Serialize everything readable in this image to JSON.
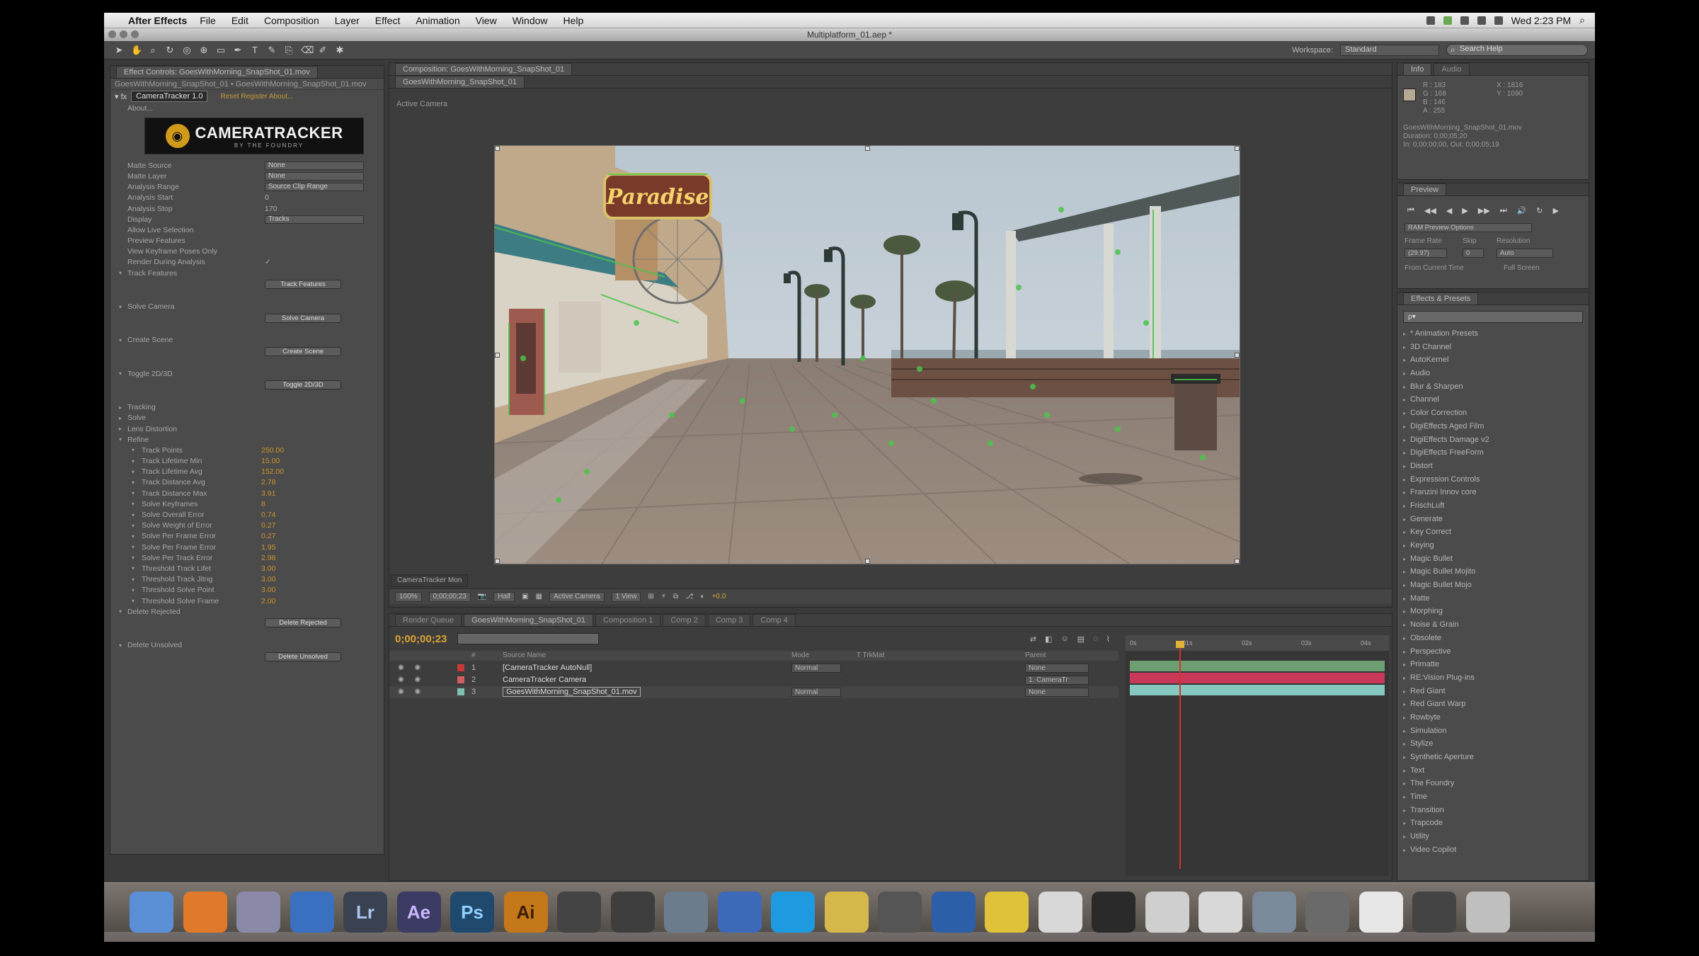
{
  "menubar": {
    "app": "After Effects",
    "items": [
      "File",
      "Edit",
      "Composition",
      "Layer",
      "Effect",
      "Animation",
      "View",
      "Window",
      "Help"
    ],
    "clock": "Wed 2:23 PM"
  },
  "window_title": "Multiplatform_01.aep *",
  "toolbar": {
    "workspace_label": "Workspace:",
    "workspace_value": "Standard",
    "help_placeholder": "Search Help"
  },
  "effect_controls": {
    "tab": "Effect Controls: GoesWithMorning_SnapShot_01.mov",
    "subtitle": "GoesWithMorning_SnapShot_01 • GoesWithMorning_SnapShot_01.mov",
    "effect_name": "CameraTracker 1.0",
    "effect_links": "Reset   Register   About...",
    "about": "About...",
    "logo_text": "CAMERATRACKER",
    "logo_sub": "BY THE FOUNDRY",
    "rows": [
      {
        "label": "Matte Source",
        "kind": "sel",
        "value": "None"
      },
      {
        "label": "Matte Layer",
        "kind": "sel",
        "value": "None"
      },
      {
        "label": "Analysis Range",
        "kind": "sel",
        "value": "Source Clip Range"
      },
      {
        "label": "Analysis Start",
        "kind": "val",
        "value": "0"
      },
      {
        "label": "Analysis Stop",
        "kind": "val",
        "value": "170"
      },
      {
        "label": "Display",
        "kind": "sel",
        "value": "Tracks"
      },
      {
        "label": "Allow Live Selection",
        "kind": "val",
        "value": ""
      },
      {
        "label": "Preview Features",
        "kind": "val",
        "value": ""
      },
      {
        "label": "View Keyframe Poses Only",
        "kind": "val",
        "value": ""
      },
      {
        "label": "Render During Analysis",
        "kind": "val",
        "value": "✓"
      },
      {
        "label": "Track Features",
        "kind": "sec",
        "value": ""
      },
      {
        "label": "",
        "kind": "btn",
        "value": "Track Features"
      },
      {
        "label": "",
        "kind": "gap",
        "value": ""
      },
      {
        "label": "Solve Camera",
        "kind": "sec",
        "value": ""
      },
      {
        "label": "",
        "kind": "btn",
        "value": "Solve Camera"
      },
      {
        "label": "",
        "kind": "gap",
        "value": ""
      },
      {
        "label": "Create Scene",
        "kind": "sec",
        "value": ""
      },
      {
        "label": "",
        "kind": "btn",
        "value": "Create Scene"
      },
      {
        "label": "",
        "kind": "gap",
        "value": ""
      },
      {
        "label": "Toggle 2D/3D",
        "kind": "sec",
        "value": ""
      },
      {
        "label": "",
        "kind": "btn",
        "value": "Toggle 2D/3D"
      },
      {
        "label": "",
        "kind": "gap",
        "value": ""
      },
      {
        "label": "Tracking",
        "kind": "sec2",
        "value": ""
      },
      {
        "label": "Solve",
        "kind": "sec2",
        "value": ""
      },
      {
        "label": "Lens Distortion",
        "kind": "sec2",
        "value": ""
      },
      {
        "label": "Refine",
        "kind": "sec",
        "value": ""
      },
      {
        "label": "Track Points",
        "kind": "gold",
        "value": "250.00"
      },
      {
        "label": "Track Lifetime Min",
        "kind": "gold",
        "value": "15.00"
      },
      {
        "label": "Track Lifetime Avg",
        "kind": "gold",
        "value": "152.00"
      },
      {
        "label": "Track Distance Avg",
        "kind": "gold",
        "value": "2.78"
      },
      {
        "label": "Track Distance Max",
        "kind": "gold",
        "value": "3.91"
      },
      {
        "label": "Solve Keyframes",
        "kind": "gold",
        "value": "8"
      },
      {
        "label": "Solve Overall Error",
        "kind": "gold",
        "value": "0.74"
      },
      {
        "label": "Solve Weight of Error",
        "kind": "gold",
        "value": "0.27"
      },
      {
        "label": "Solve Per Frame Error",
        "kind": "gold",
        "value": "0.27"
      },
      {
        "label": "Solve Per Frame Error",
        "kind": "gold",
        "value": "1.95"
      },
      {
        "label": "Solve Per Track Error",
        "kind": "gold",
        "value": "2.98"
      },
      {
        "label": "Threshold Track Lifet",
        "kind": "gold",
        "value": "3.00"
      },
      {
        "label": "Threshold Track Jitng",
        "kind": "gold",
        "value": "3.00"
      },
      {
        "label": "Threshold Solve Point",
        "kind": "gold",
        "value": "3.00"
      },
      {
        "label": "Threshold Solve Frame",
        "kind": "gold",
        "value": "2.00"
      },
      {
        "label": "Delete Rejected",
        "kind": "sec",
        "value": ""
      },
      {
        "label": "",
        "kind": "btn",
        "value": "Delete Rejected"
      },
      {
        "label": "",
        "kind": "gap",
        "value": ""
      },
      {
        "label": "Delete Unsolved",
        "kind": "sec",
        "value": ""
      },
      {
        "label": "",
        "kind": "btn",
        "value": "Delete Unsolved"
      }
    ]
  },
  "composition": {
    "tab": "Composition: GoesWithMorning_SnapShot_01",
    "subtab": "GoesWithMorning_SnapShot_01",
    "view_label": "Active Camera",
    "sign_text": "Paradise",
    "mini_tab": "CameraTracker Mon",
    "bottom": {
      "zoom": "100%",
      "timecode": "0;00;00;23",
      "resolution": "Half",
      "view": "Active Camera",
      "views": "1 View",
      "offset": "+0.0"
    }
  },
  "timeline": {
    "tabs": [
      "Render Queue",
      "GoesWithMorning_SnapShot_01",
      "Composition 1",
      "Comp 2",
      "Comp 3",
      "Comp 4"
    ],
    "time": "0;00;00;23",
    "columns": [
      "#",
      "Source Name",
      "Mode",
      "T TrkMat",
      "Parent"
    ],
    "layers": [
      {
        "num": "1",
        "name": "[CameraTracker AutoNull]",
        "mode": "Normal",
        "parent": "None",
        "color": "#c83a3a"
      },
      {
        "num": "2",
        "name": "CameraTracker Camera",
        "mode": "",
        "parent": "1. CameraTr",
        "color": "#d06060"
      },
      {
        "num": "3",
        "name": "GoesWithMorning_SnapShot_01.mov",
        "mode": "Normal",
        "parent": "None",
        "color": "#7fbfb4"
      }
    ],
    "ruler": [
      "0s",
      "01s",
      "02s",
      "03s",
      "04s"
    ],
    "bar_colors": [
      "#6d9e72",
      "#c8395a",
      "#85c8c0"
    ]
  },
  "info_panel": {
    "tabs": [
      "Info",
      "Audio"
    ],
    "r": "R : 183",
    "g": "G : 168",
    "b": "B : 146",
    "a": "A : 255",
    "x": "X : 1816",
    "y": "Y : 1090",
    "desc1": "GoesWithMorning_SnapShot_01.mov",
    "desc2": "Duration: 0;00;05;20",
    "desc3": "In: 0;00;00;00, Out: 0;00;05;19"
  },
  "preview_panel": {
    "tab": "Preview",
    "controls": [
      "⏮",
      "◀◀",
      "◀",
      "▶",
      "▶▶",
      "⏭",
      "🔊",
      "↻",
      "▶"
    ],
    "ram_label": "RAM Preview Options",
    "frame_rate_label": "Frame Rate",
    "skip_label": "Skip",
    "resolution_label": "Resolution",
    "frame_rate": "(29.97)",
    "skip": "0",
    "resolution": "Auto",
    "from_current": "From Current Time",
    "full_screen": "Full Screen"
  },
  "effects_panel": {
    "tab": "Effects & Presets",
    "search": "ρ▾",
    "items": [
      "* Animation Presets",
      "3D Channel",
      "AutoKernel",
      "Audio",
      "Blur & Sharpen",
      "Channel",
      "Color Correction",
      "DigiEffects Aged Film",
      "DigiEffects Damage v2",
      "DigiEffects FreeForm",
      "Distort",
      "Expression Controls",
      "Franzini Innov core",
      "FrischLuft",
      "Generate",
      "Key Correct",
      "Keying",
      "Magic Bullet",
      "Magic Bullet Mojito",
      "Magic Bullet Mojo",
      "Matte",
      "Morphing",
      "Noise & Grain",
      "Obsolete",
      "Perspective",
      "Primatte",
      "RE:Vision Plug-ins",
      "Red Giant",
      "Red Giant Warp",
      "Rowbyte",
      "Simulation",
      "Stylize",
      "Synthetic Aperture",
      "Text",
      "The Foundry",
      "Time",
      "Transition",
      "Trapcode",
      "Utility",
      "Video Copilot"
    ]
  },
  "dock": {
    "items": [
      {
        "name": "finder",
        "label": "",
        "bg": "#5a8fd6"
      },
      {
        "name": "firefox",
        "label": "",
        "bg": "#e07a2a"
      },
      {
        "name": "iphoto",
        "label": "",
        "bg": "#8a8aa8"
      },
      {
        "name": "safari",
        "label": "",
        "bg": "#3a70c0"
      },
      {
        "name": "lightroom",
        "label": "Lr",
        "bg": "#3a4252"
      },
      {
        "name": "after-effects",
        "label": "Ae",
        "bg": "#3c3b63"
      },
      {
        "name": "photoshop",
        "label": "Ps",
        "bg": "#20496e"
      },
      {
        "name": "illustrator",
        "label": "Ai",
        "bg": "#c4781a"
      },
      {
        "name": "final-cut",
        "label": "",
        "bg": "#444"
      },
      {
        "name": "motion",
        "label": "",
        "bg": "#3e3e3e"
      },
      {
        "name": "preview-app",
        "label": "",
        "bg": "#6c7c8c"
      },
      {
        "name": "itunes",
        "label": "",
        "bg": "#3c6ab8"
      },
      {
        "name": "skype",
        "label": "",
        "bg": "#1e9be0"
      },
      {
        "name": "transmit",
        "label": "",
        "bg": "#d6b84a"
      },
      {
        "name": "compressor",
        "label": "",
        "bg": "#555"
      },
      {
        "name": "quicktime",
        "label": "",
        "bg": "#2d5ea8"
      },
      {
        "name": "todo",
        "label": "",
        "bg": "#e0c23a"
      },
      {
        "name": "textedit",
        "label": "",
        "bg": "#d8d8d8"
      },
      {
        "name": "window-1",
        "label": "",
        "bg": "#2a2a2a"
      },
      {
        "name": "window-2",
        "label": "",
        "bg": "#cfcfcf"
      },
      {
        "name": "window-3",
        "label": "",
        "bg": "#d8d8d8"
      },
      {
        "name": "window-4",
        "label": "",
        "bg": "#7a8a9a"
      },
      {
        "name": "window-5",
        "label": "",
        "bg": "#6a6a6a"
      },
      {
        "name": "window-6",
        "label": "",
        "bg": "#e6e6e6"
      },
      {
        "name": "window-7",
        "label": "",
        "bg": "#444"
      },
      {
        "name": "trash",
        "label": "",
        "bg": "#bfbfbf"
      }
    ]
  }
}
